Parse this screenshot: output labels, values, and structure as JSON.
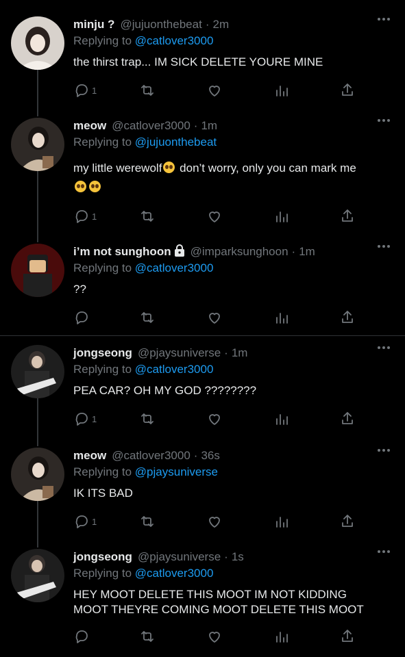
{
  "tweets": [
    {
      "name": "minju ?",
      "handle": "@jujuonthebeat",
      "time": "2m",
      "replying_prefix": "Replying to",
      "replying_to": "@catlover3000",
      "text": "the thirst trap... IM SICK DELETE YOURE MINE",
      "reply_count": "1",
      "avatar_colors": [
        "#d9d4cf",
        "#2a2220",
        "#f1ece8"
      ]
    },
    {
      "name": "meow",
      "handle": "@catlover3000",
      "time": "1m",
      "replying_prefix": "Replying to",
      "replying_to": "@jujuonthebeat",
      "text_a": "my little werewolf",
      "text_b": "don’t worry, only you can mark me",
      "reply_count": "1",
      "avatar_colors": [
        "#3a3330",
        "#c9b9a6",
        "#1a1614"
      ]
    },
    {
      "name": "i’m not sunghoon",
      "handle": "@imparksunghoon",
      "time": "1m",
      "replying_prefix": "Replying to",
      "replying_to": "@catlover3000",
      "text": "??",
      "reply_count": "",
      "avatar_colors": [
        "#5a0d0d",
        "#e0b98b",
        "#1a1a1a"
      ]
    },
    {
      "name": "jongseong",
      "handle": "@pjaysuniverse",
      "time": "1m",
      "replying_prefix": "Replying to",
      "replying_to": "@catlover3000",
      "text": "PEA CAR? OH MY GOD ????????",
      "reply_count": "1",
      "avatar_colors": [
        "#1f1f1f",
        "#dcdcdc",
        "#555"
      ]
    },
    {
      "name": "meow",
      "handle": "@catlover3000",
      "time": "36s",
      "replying_prefix": "Replying to",
      "replying_to": "@pjaysuniverse",
      "text": "IK ITS BAD",
      "reply_count": "1",
      "avatar_colors": [
        "#3a3330",
        "#c9b9a6",
        "#1a1614"
      ]
    },
    {
      "name": "jongseong",
      "handle": "@pjaysuniverse",
      "time": "1s",
      "replying_prefix": "Replying to",
      "replying_to": "@catlover3000",
      "text": "HEY MOOT DELETE THIS MOOT IM NOT KIDDING MOOT THEYRE COMING MOOT DELETE THIS MOOT",
      "reply_count": "",
      "avatar_colors": [
        "#1f1f1f",
        "#dcdcdc",
        "#555"
      ]
    }
  ],
  "colors": {
    "background": "#000000",
    "text": "#e7e9ea",
    "muted": "#71767b",
    "link": "#1d9bf0",
    "divider": "#2f3336"
  },
  "icons": [
    "reply-icon",
    "retweet-icon",
    "like-icon",
    "views-icon",
    "share-icon",
    "more-icon",
    "lock-icon",
    "pleading-face-emoji"
  ]
}
